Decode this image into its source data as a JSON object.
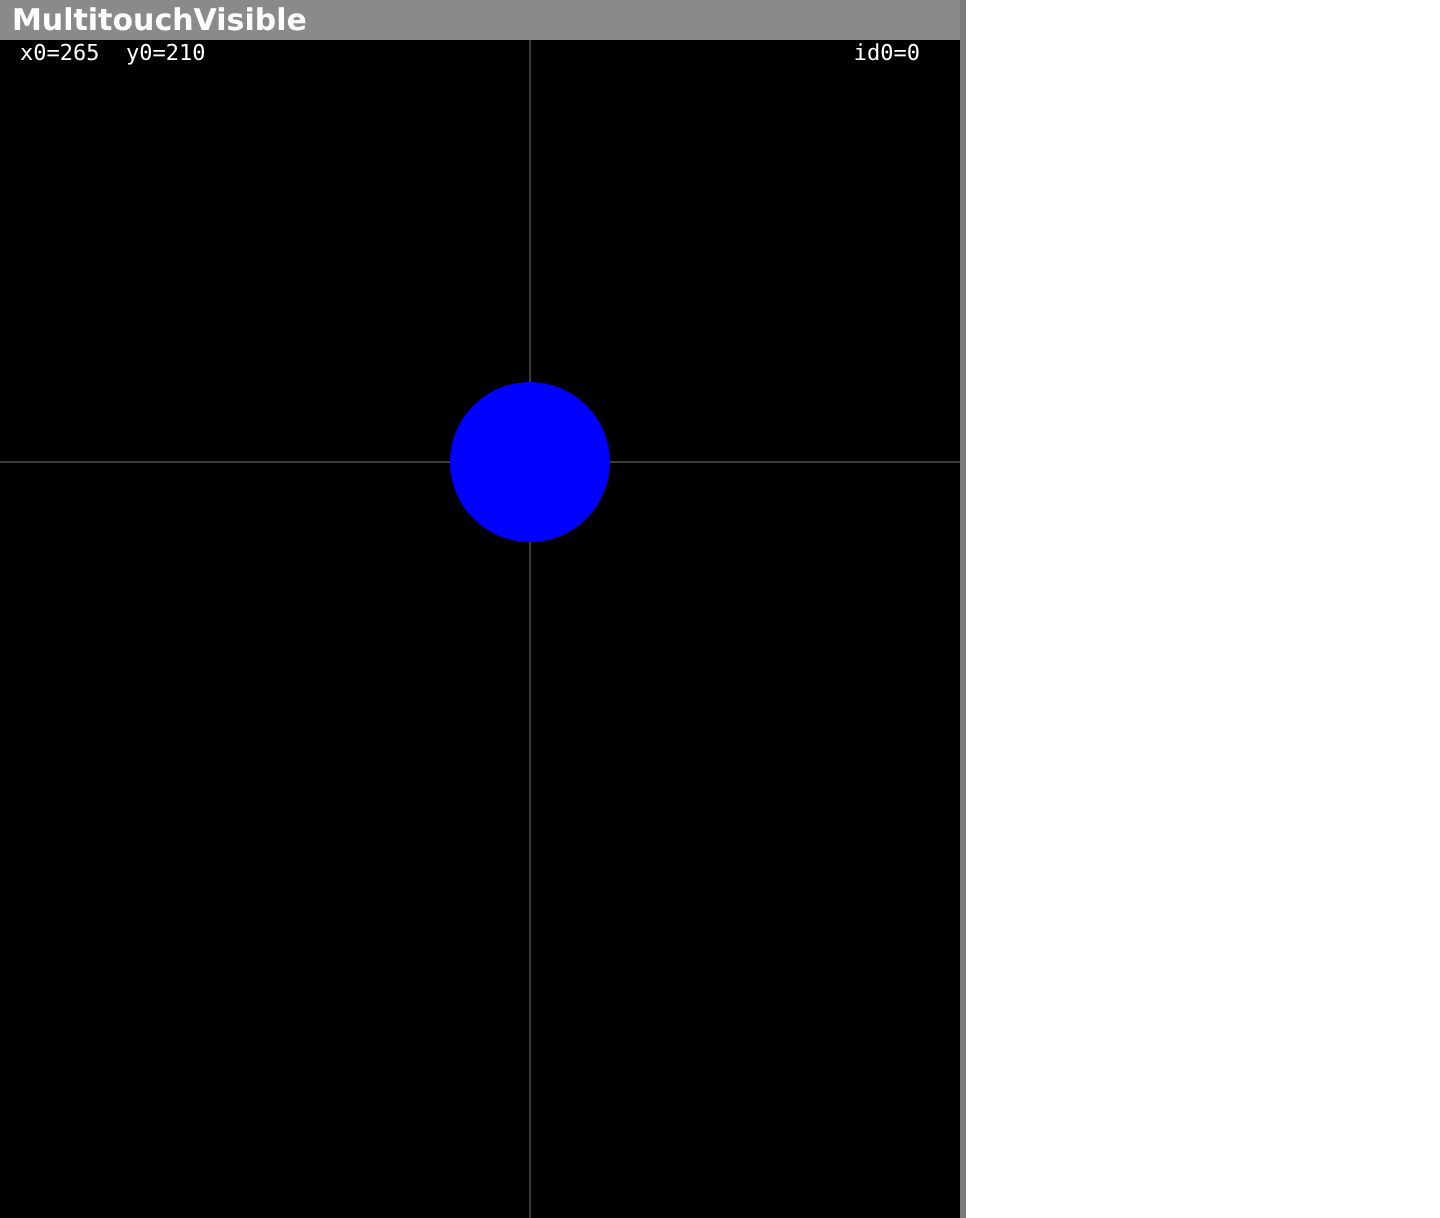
{
  "window": {
    "title": "MultitouchVisible"
  },
  "touch_readout": {
    "coords": "x0=265  y0=210",
    "pointer_id": "id0=0"
  }
}
